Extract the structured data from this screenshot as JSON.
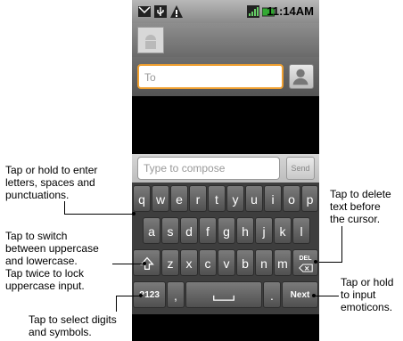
{
  "status": {
    "time": "11:14AM"
  },
  "header": {},
  "to": {
    "placeholder": "To"
  },
  "compose": {
    "placeholder": "Type to compose",
    "send_label": "Send"
  },
  "keyboard": {
    "row1": [
      "q",
      "w",
      "e",
      "r",
      "t",
      "y",
      "u",
      "i",
      "o",
      "p"
    ],
    "row2": [
      "a",
      "s",
      "d",
      "f",
      "g",
      "h",
      "j",
      "k",
      "l"
    ],
    "row3": [
      "z",
      "x",
      "c",
      "v",
      "b",
      "n",
      "m"
    ],
    "del_label": "DEL",
    "sym_label": "?123",
    "comma": ",",
    "period": ".",
    "next_label": "Next"
  },
  "annotations": {
    "letters": [
      "Tap or hold to enter",
      "letters, spaces and",
      "punctuations."
    ],
    "shift": [
      "Tap to switch",
      "between uppercase",
      "and lowercase.",
      "Tap twice to lock",
      "uppercase input."
    ],
    "symbols": [
      "Tap to select digits",
      "and symbols."
    ],
    "delete": [
      "Tap to delete",
      "text before",
      "the cursor."
    ],
    "emoticons": [
      "Tap or hold",
      "to input",
      "emoticons."
    ]
  }
}
